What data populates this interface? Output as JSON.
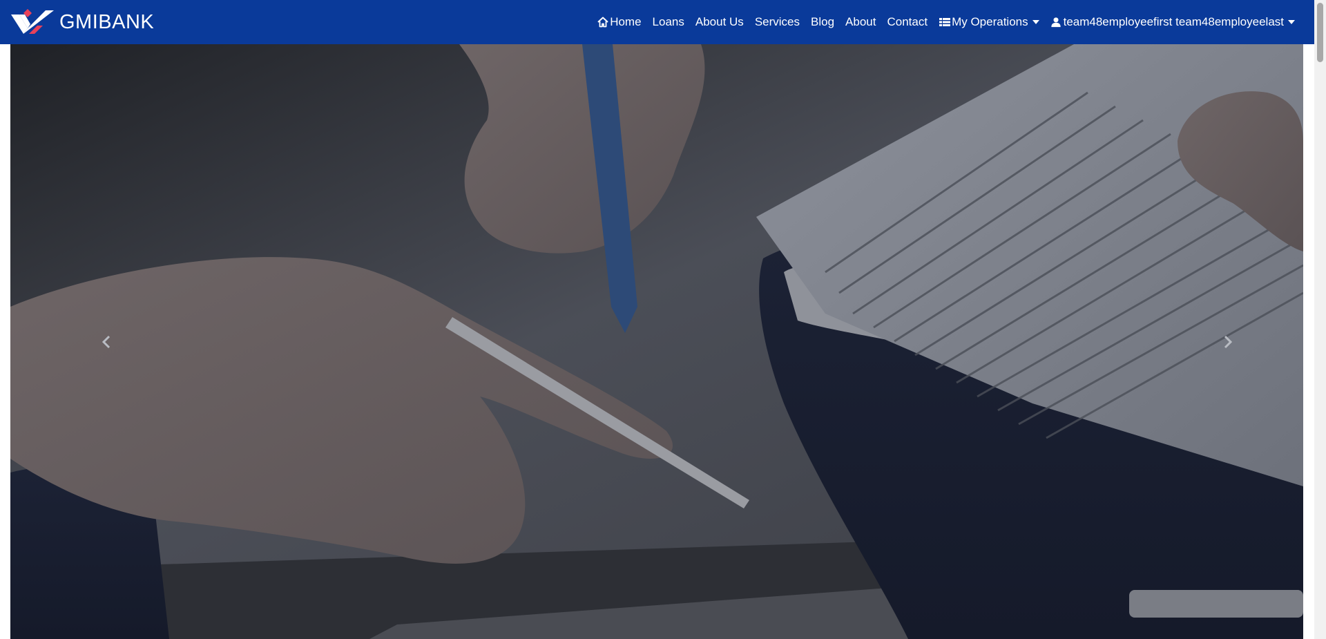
{
  "brand": {
    "name": "GMIBANK",
    "logo_icon": "gmibank-logo",
    "colors": {
      "navbar": "#0a3a9a",
      "logo_red": "#e8415a",
      "logo_white": "#ffffff"
    }
  },
  "nav": {
    "home": {
      "label": "Home",
      "icon": "home-icon"
    },
    "loans": {
      "label": "Loans"
    },
    "about_us": {
      "label": "About Us"
    },
    "services": {
      "label": "Services"
    },
    "blog": {
      "label": "Blog"
    },
    "about": {
      "label": "About"
    },
    "contact": {
      "label": "Contact"
    },
    "my_operations": {
      "label": "My Operations",
      "icon": "table-list-icon"
    },
    "user": {
      "label": "team48employeefirst team48employeelast",
      "icon": "user-icon"
    }
  },
  "carousel": {
    "prev_icon": "chevron-left-icon",
    "next_icon": "chevron-right-icon",
    "slide_description_icon": "business-document-photo"
  }
}
